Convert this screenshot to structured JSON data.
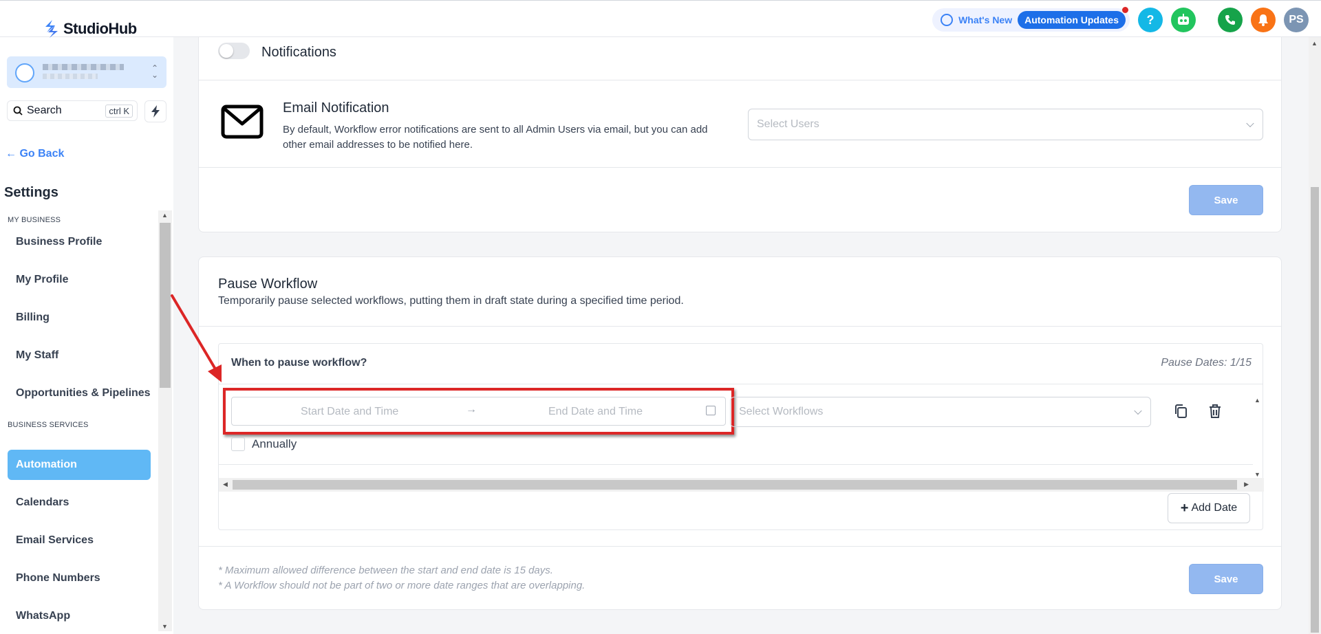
{
  "brand": {
    "name": "StudioHub"
  },
  "topbar": {
    "whats_new": "What's New",
    "automation_updates": "Automation Updates",
    "help": "?",
    "avatar": "PS"
  },
  "sidebar": {
    "search_label": "Search",
    "search_shortcut": "ctrl K",
    "go_back": "Go Back",
    "settings_title": "Settings",
    "section_my_business": "MY BUSINESS",
    "section_business_services": "BUSINESS SERVICES",
    "items": [
      {
        "label": "Business Profile"
      },
      {
        "label": "My Profile"
      },
      {
        "label": "Billing"
      },
      {
        "label": "My Staff"
      },
      {
        "label": "Opportunities & Pipelines"
      },
      {
        "label": "Automation",
        "active": true
      },
      {
        "label": "Calendars"
      },
      {
        "label": "Email Services"
      },
      {
        "label": "Phone Numbers"
      },
      {
        "label": "WhatsApp"
      }
    ]
  },
  "notifications": {
    "toggle_label": "Notifications",
    "toggle_on": false,
    "email_title": "Email Notification",
    "email_desc": "By default, Workflow error notifications are sent to all Admin Users via email, but you can add other email addresses to be notified here.",
    "select_users_placeholder": "Select Users",
    "save_label": "Save"
  },
  "pause_workflow": {
    "title": "Pause Workflow",
    "description": "Temporarily pause selected workflows, putting them in draft state during a specified time period.",
    "when_label": "When to pause workflow?",
    "pause_dates": "Pause Dates: 1/15",
    "start_placeholder": "Start Date and Time",
    "end_placeholder": "End Date and Time",
    "select_workflows_placeholder": "Select Workflows",
    "annually_label": "Annually",
    "annually_checked": false,
    "add_date_label": "Add Date",
    "note1": "* Maximum allowed difference between the start and end date is 15 days.",
    "note2": "* A Workflow should not be part of two or more date ranges that are overlapping.",
    "save_label": "Save"
  },
  "colors": {
    "accent": "#1d6fe8",
    "active_nav": "#60b8f5",
    "save_button": "#93b8f0",
    "annotation": "#dc2626"
  }
}
